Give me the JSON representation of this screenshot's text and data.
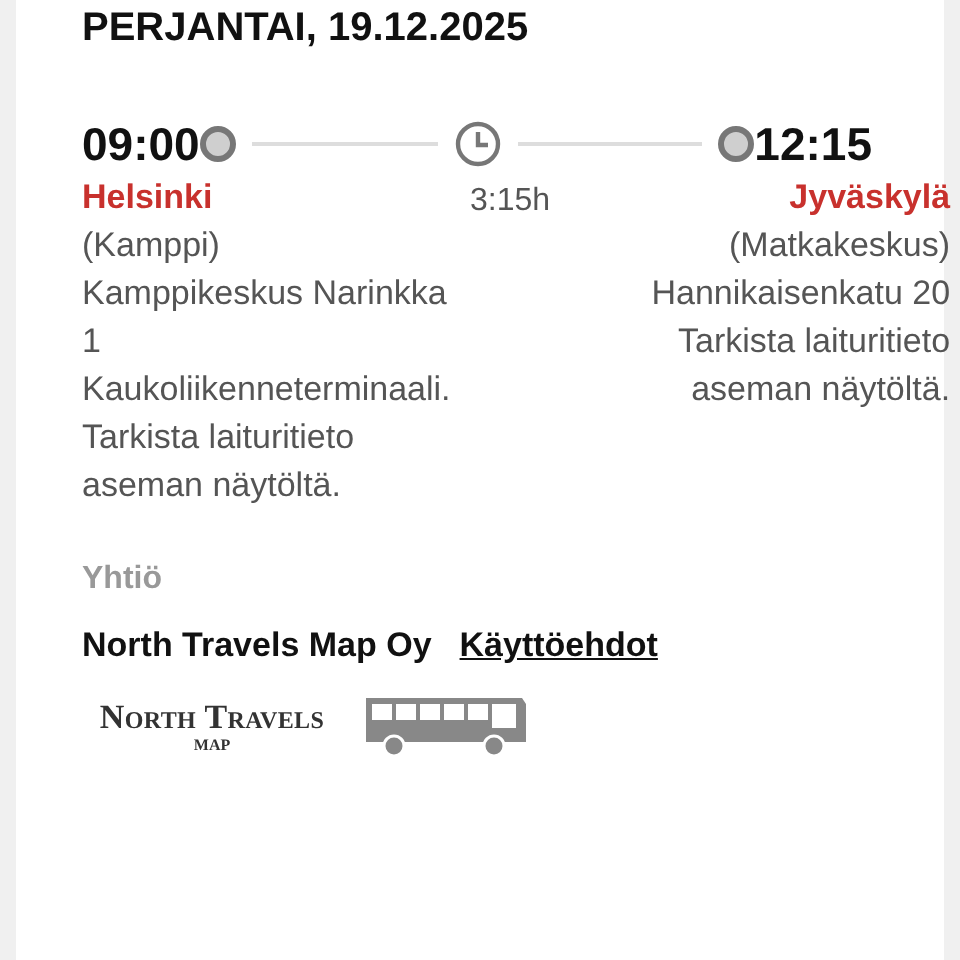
{
  "date": "PERJANTAI, 19.12.2025",
  "departure": {
    "time": "09:00",
    "city": "Helsinki",
    "station": "(Kamppi)",
    "details": "Kamppikeskus Narinkka 1 Kaukoliikenneterminaali. Tarkista laituritieto aseman näytöltä."
  },
  "duration": "3:15h",
  "arrival": {
    "time": "12:15",
    "city": "Jyväskylä",
    "station": "(Matkakeskus)",
    "details": "Hannikaisenkatu 20 Tarkista laituritieto aseman näytöltä."
  },
  "company": {
    "label": "Yhtiö",
    "name": "North Travels Map Oy",
    "terms_link": "Käyttöehdot"
  },
  "logo": {
    "line1": "North Travels",
    "line2": "MAP"
  }
}
